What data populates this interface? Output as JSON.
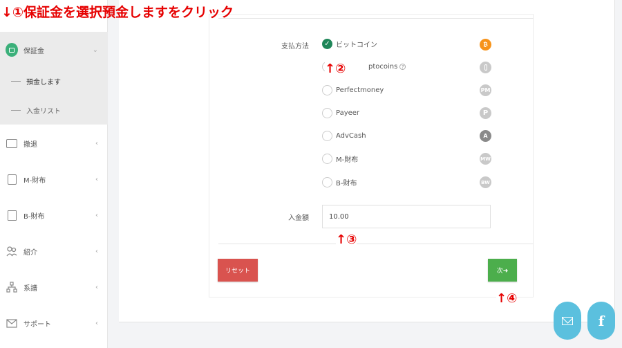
{
  "annotations": {
    "step1": "↓①保証金を選択預金しますをクリック",
    "step2": "↑②",
    "step3": "↑③",
    "step4": "↑④"
  },
  "sidebar": {
    "active_menu": {
      "label": "保証金",
      "icon": "deposit-icon",
      "chevron": "⌄"
    },
    "sub_items": [
      {
        "label": "預金します"
      },
      {
        "label": "入金リスト"
      }
    ],
    "items": [
      {
        "label": "撤退",
        "icon": "withdraw-icon",
        "chevron": "‹"
      },
      {
        "label": "M-財布",
        "icon": "wallet-icon",
        "chevron": "‹"
      },
      {
        "label": "B-財布",
        "icon": "safe-icon",
        "chevron": "‹"
      },
      {
        "label": "紹介",
        "icon": "referral-icon",
        "chevron": "‹"
      },
      {
        "label": "系譜",
        "icon": "tree-icon",
        "chevron": "‹"
      },
      {
        "label": "サポート",
        "icon": "mail-icon",
        "chevron": "‹"
      }
    ]
  },
  "form": {
    "payment_label": "支払方法",
    "options": [
      {
        "label": "ビットコイン",
        "coin": "₿",
        "checked": true
      },
      {
        "label": "ptocoins",
        "coin": "",
        "checked": false,
        "help": "?"
      },
      {
        "label": "Perfectmoney",
        "coin": "PM",
        "checked": false
      },
      {
        "label": "Payeer",
        "coin": "P",
        "checked": false
      },
      {
        "label": "AdvCash",
        "coin": "A",
        "checked": false
      },
      {
        "label": "M-財布",
        "coin": "MW",
        "checked": false
      },
      {
        "label": "B-財布",
        "coin": "BW",
        "checked": false
      }
    ],
    "amount_label": "入金額",
    "amount_value": "10.00",
    "reset_label": "リセット",
    "next_label": "次➜"
  },
  "colors": {
    "annotation": "#e60000",
    "reset": "#d9534f",
    "next": "#4cae4c",
    "fab": "#5bc0de",
    "btc": "#f7931a"
  }
}
